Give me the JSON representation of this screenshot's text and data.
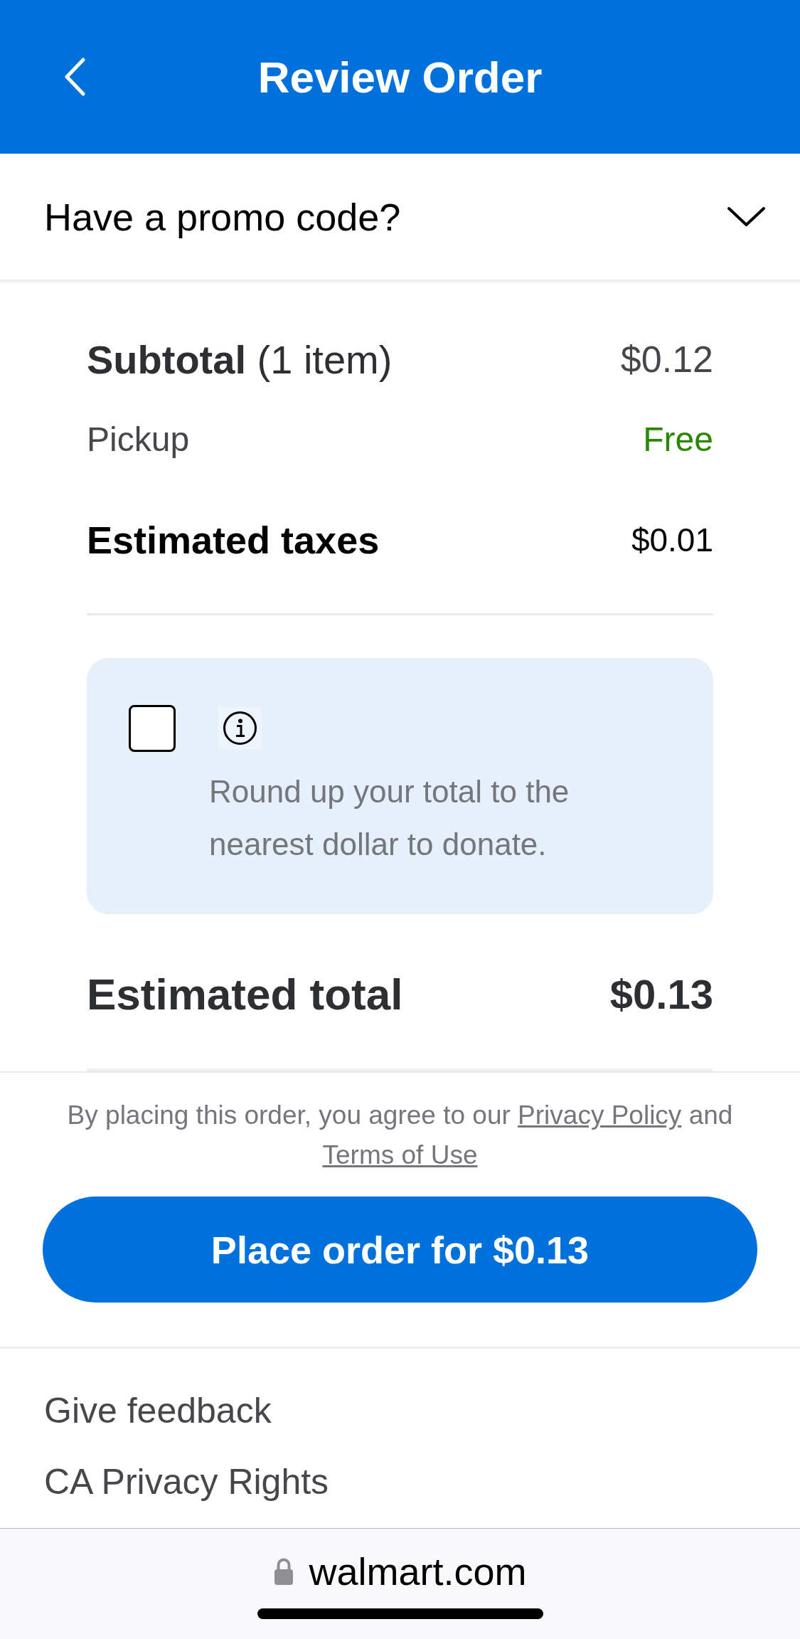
{
  "header": {
    "title": "Review Order"
  },
  "promo": {
    "label": "Have a promo code?",
    "expanded": false
  },
  "summary": {
    "lines": [
      {
        "kind": "subtotal",
        "label": "**Subtotal** (1 item)",
        "value": "$0.12"
      },
      {
        "kind": "fee",
        "label": "Pickup",
        "value": "Free"
      },
      {
        "kind": "tax",
        "label": "Estimated taxes",
        "value": "$0.01"
      }
    ]
  },
  "donation": {
    "checked": false,
    "text": "Round up your total to the nearest dollar to donate."
  },
  "total": {
    "label": "Estimated total",
    "value": "$0.13"
  },
  "legal": {
    "text": "By placing this order, you agree to our",
    "privacy_link": "Privacy Policy",
    "conjunction": "and",
    "terms_link": "Terms of Use"
  },
  "place_order_button": {
    "label": "Place order for $0.13"
  },
  "footer_links": [
    {
      "label": "Give feedback"
    },
    {
      "label": "CA Privacy Rights"
    }
  ],
  "browser_bar": {
    "url": "walmart.com"
  }
}
